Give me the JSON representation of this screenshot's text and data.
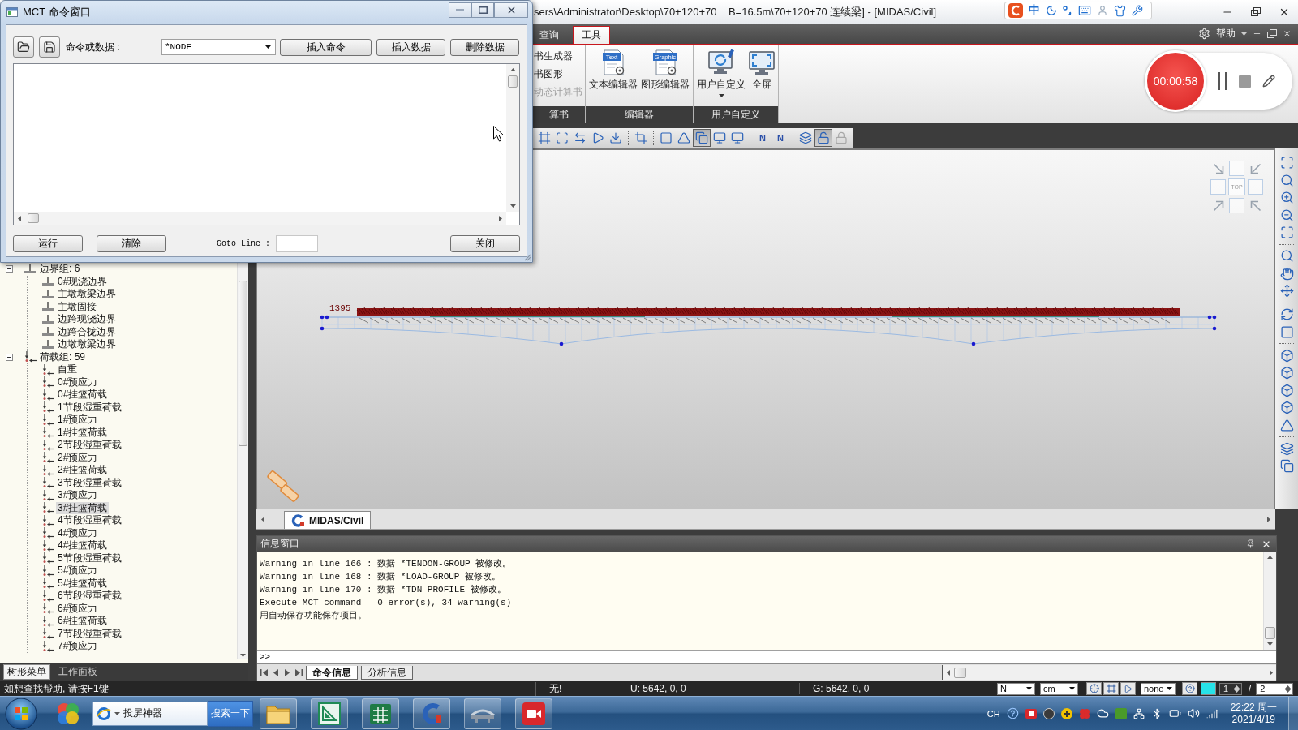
{
  "main_window": {
    "title": "sers\\Administrator\\Desktop\\70+120+70    B=16.5m\\70+120+70 连续梁] - [MIDAS/Civil]"
  },
  "mct_window": {
    "title": "MCT 命令窗口",
    "input_label": "命令或数据 :",
    "command_select": {
      "value": "*NODE"
    },
    "actions": [
      "插入命令",
      "插入数据",
      "删除数据"
    ],
    "footer_buttons": [
      "运行",
      "清除"
    ],
    "goto_label": "Goto Line :",
    "close_button": "关闭"
  },
  "ime_bar": {
    "mode": "中"
  },
  "ribbon": {
    "tabs": [
      {
        "label": "查询",
        "selected": false
      },
      {
        "label": "工具",
        "selected": true
      }
    ],
    "help": "帮助",
    "groups": [
      {
        "label": "算书",
        "kind": "list",
        "items": [
          {
            "label": "书生成器",
            "disabled": false
          },
          {
            "label": "书图形",
            "disabled": false
          },
          {
            "label": "动态计算书",
            "disabled": true
          }
        ]
      },
      {
        "label": "编辑器",
        "kind": "large",
        "items": [
          {
            "label": "文本编辑器",
            "badge": "Text",
            "dropdown": false
          },
          {
            "label": "图形编辑器",
            "badge": "Graphic",
            "dropdown": false
          }
        ]
      },
      {
        "label": "用户自定义",
        "kind": "large",
        "items": [
          {
            "label": "用户自定义",
            "dropdown": true
          },
          {
            "label": "全屏",
            "dropdown": false
          }
        ]
      }
    ]
  },
  "recorder": {
    "elapsed": "00:00:58"
  },
  "view_toolbar": {
    "groups": [
      [
        {
          "pressed": false,
          "disabled": false
        },
        {
          "pressed": false,
          "disabled": false
        },
        {
          "pressed": false,
          "disabled": false
        },
        {
          "pressed": false,
          "disabled": false
        },
        {
          "pressed": false,
          "disabled": false
        }
      ],
      [
        {
          "pressed": false,
          "disabled": false
        }
      ],
      [
        {
          "pressed": false,
          "disabled": false
        },
        {
          "pressed": false,
          "disabled": false
        },
        {
          "pressed": true,
          "disabled": false
        },
        {
          "pressed": false,
          "disabled": false
        },
        {
          "pressed": false,
          "disabled": false
        }
      ],
      [
        {
          "label": "N",
          "pressed": false,
          "disabled": false
        },
        {
          "label": "N",
          "pressed": false,
          "disabled": false
        }
      ],
      [
        {
          "pressed": false,
          "disabled": false
        },
        {
          "pressed": true,
          "disabled": false
        },
        {
          "pressed": false,
          "disabled": true
        }
      ]
    ]
  },
  "viewport": {
    "node_label": "1395",
    "view_cube": "TOP"
  },
  "doc_tabs": [
    {
      "label": "MIDAS/Civil",
      "selected": true
    }
  ],
  "tree": {
    "groups": [
      {
        "label": "边界组: 6",
        "kind": "boundary",
        "expanded": true,
        "selected": false,
        "children": [
          {
            "label": "0#现浇边界",
            "selected": false
          },
          {
            "label": "主墩墩梁边界",
            "selected": false
          },
          {
            "label": "主墩固接",
            "selected": false
          },
          {
            "label": "边跨现浇边界",
            "selected": false
          },
          {
            "label": "边跨合拢边界",
            "selected": false
          },
          {
            "label": "边墩墩梁边界",
            "selected": false
          }
        ]
      },
      {
        "label": "荷载组: 59",
        "kind": "load",
        "expanded": true,
        "selected": false,
        "children": [
          {
            "label": "自重",
            "selected": false
          },
          {
            "label": "0#预应力",
            "selected": false
          },
          {
            "label": "0#挂篮荷载",
            "selected": false
          },
          {
            "label": "1节段湿重荷载",
            "selected": false
          },
          {
            "label": "1#预应力",
            "selected": false
          },
          {
            "label": "1#挂篮荷载",
            "selected": false
          },
          {
            "label": "2节段湿重荷载",
            "selected": false
          },
          {
            "label": "2#预应力",
            "selected": false
          },
          {
            "label": "2#挂篮荷载",
            "selected": false
          },
          {
            "label": "3节段湿重荷载",
            "selected": false
          },
          {
            "label": "3#预应力",
            "selected": false
          },
          {
            "label": "3#挂篮荷载",
            "selected": true
          },
          {
            "label": "4节段湿重荷载",
            "selected": false
          },
          {
            "label": "4#预应力",
            "selected": false
          },
          {
            "label": "4#挂篮荷载",
            "selected": false
          },
          {
            "label": "5节段湿重荷载",
            "selected": false
          },
          {
            "label": "5#预应力",
            "selected": false
          },
          {
            "label": "5#挂篮荷载",
            "selected": false
          },
          {
            "label": "6节段湿重荷载",
            "selected": false
          },
          {
            "label": "6#预应力",
            "selected": false
          },
          {
            "label": "6#挂篮荷载",
            "selected": false
          },
          {
            "label": "7节段湿重荷载",
            "selected": false
          },
          {
            "label": "7#预应力",
            "selected": false
          }
        ]
      }
    ]
  },
  "left_tabs": [
    {
      "label": "树形菜单",
      "selected": true
    },
    {
      "label": "工作面板",
      "selected": false
    }
  ],
  "info_window": {
    "title": "信息窗口",
    "lines": [
      "Warning in line 166 : 数据 *TENDON-GROUP 被修改。",
      "Warning in line 168 : 数据 *LOAD-GROUP 被修改。",
      "Warning in line 170 : 数据 *TDN-PROFILE 被修改。",
      "Execute MCT command - 0 error(s), 34 warning(s)",
      "用自动保存功能保存项目。"
    ],
    "prompt": ">>",
    "tabs": [
      {
        "label": "命令信息",
        "selected": true
      },
      {
        "label": "分析信息",
        "selected": false
      }
    ]
  },
  "status_bar": {
    "help": "如想查找帮助, 请按F1键",
    "message": "无!",
    "ucs": "U: 5642, 0, 0",
    "gcs": "G: 5642, 0, 0",
    "force_unit": "N",
    "length_unit": "cm",
    "filter": "none",
    "page": "1",
    "page_separator": "/",
    "page_count": "2"
  },
  "taskbar": {
    "search": {
      "value": "投屏神器"
    },
    "search_button": "搜索一下",
    "language": "CH",
    "time": "22:22 周一",
    "date": "2021/4/19"
  }
}
